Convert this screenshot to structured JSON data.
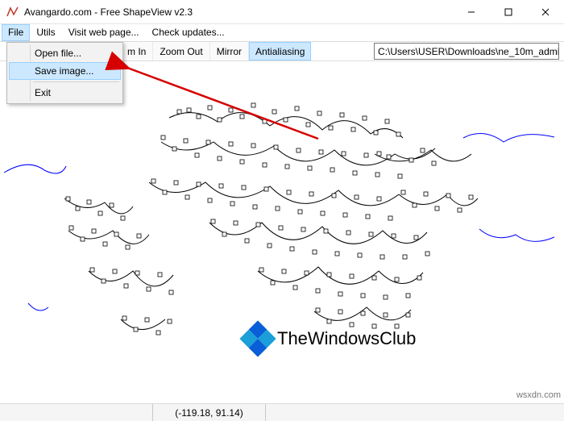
{
  "title": "Avangardo.com - Free ShapeView v2.3",
  "menubar": {
    "file": "File",
    "utils": "Utils",
    "visit": "Visit web page...",
    "check": "Check updates..."
  },
  "dropdown": {
    "open": "Open file...",
    "save": "Save image...",
    "exit": "Exit"
  },
  "toolbar": {
    "zoom_in": "m In",
    "zoom_out": "Zoom Out",
    "mirror": "Mirror",
    "antialias": "Antialiasing",
    "path": "C:\\Users\\USER\\Downloads\\ne_10m_admin_0_bound"
  },
  "statusbar": {
    "coords": "(-119.18, 91.14)"
  },
  "logo_text": "TheWindowsClub",
  "watermark": "wsxdn.com"
}
